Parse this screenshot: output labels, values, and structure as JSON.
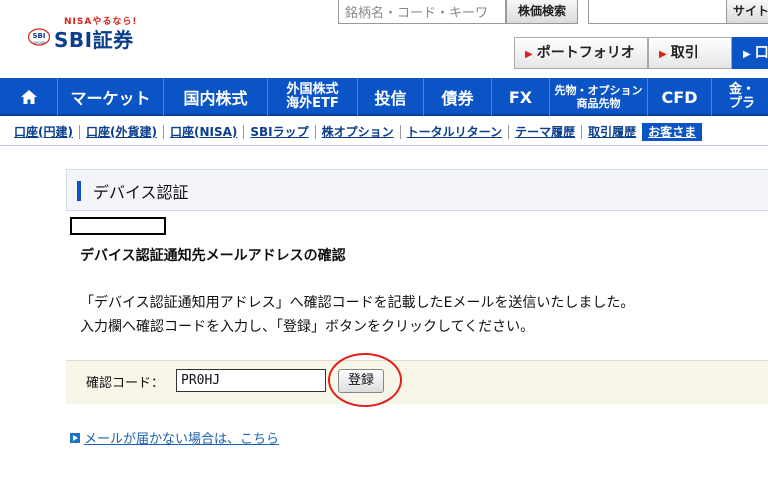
{
  "brand": {
    "tagline": "NISAやるなら!",
    "mark_text": "SBI",
    "mark_sub": "GROUP",
    "name": "SBI証券",
    "accent_color": "#0a54c6",
    "red_color": "#d9241b"
  },
  "header": {
    "search_placeholder": "銘柄名・コード・キーワ",
    "stock_search_label": "株価検索",
    "site_search_label": "サイト",
    "quick_links": [
      "ポートフォリオ",
      "取引",
      "口"
    ]
  },
  "main_nav": {
    "home_icon": "home-icon",
    "items": [
      {
        "label": "マーケット"
      },
      {
        "label": "国内株式"
      },
      {
        "label_line1": "外国株式",
        "label_line2": "海外ETF"
      },
      {
        "label": "投信"
      },
      {
        "label": "債券"
      },
      {
        "label": "FX"
      },
      {
        "label_line1": "先物・オプション",
        "label_line2": "商品先物"
      },
      {
        "label": "CFD"
      },
      {
        "label_line1": "金・",
        "label_line2": "プラ"
      }
    ]
  },
  "sub_nav": {
    "items": [
      "口座(円建)",
      "口座(外貨建)",
      "口座(NISA)",
      "SBIラップ",
      "株オプション",
      "トータルリターン",
      "テーマ履歴",
      "取引履歴",
      "お客さま"
    ]
  },
  "page": {
    "title": "デバイス認証",
    "section_heading": "デバイス認証通知先メールアドレスの確認",
    "message_line1": "「デバイス認証通知用アドレス」へ確認コードを記載したEメールを送信いたしました。",
    "message_line2": "入力欄へ確認コードを入力し、「登録」ボタンをクリックしてください。"
  },
  "form": {
    "code_label": "確認コード：",
    "code_value": "PR0HJ",
    "register_label": "登録"
  },
  "help": {
    "link_text": "メールが届かない場合は、こちら"
  }
}
